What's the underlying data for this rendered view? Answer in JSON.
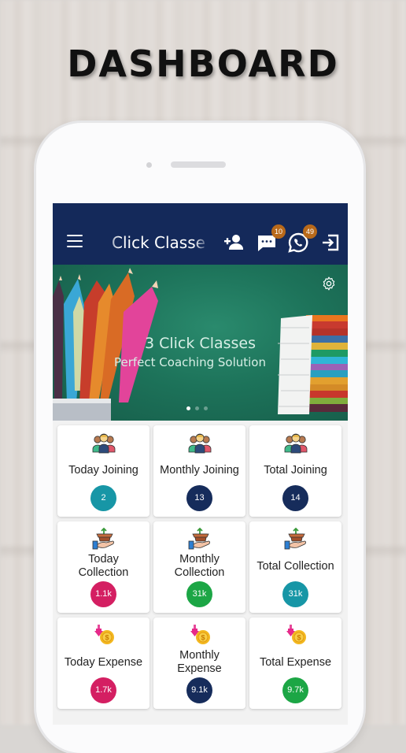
{
  "headline": "DASHBOARD",
  "app": {
    "title": "Click Classes",
    "badges": {
      "messages": "10",
      "whatsapp": "49"
    }
  },
  "banner": {
    "title": "3 Click Classes",
    "subtitle": "Perfect Coaching Solution",
    "slide_count": 3,
    "active_slide": 1
  },
  "cards": [
    {
      "label": "Today Joining",
      "value": "2",
      "icon": "people-icon",
      "color": "#1796a6"
    },
    {
      "label": "Monthly Joining",
      "value": "13",
      "icon": "people-icon",
      "color": "#162c5b"
    },
    {
      "label": "Total Joining",
      "value": "14",
      "icon": "people-icon",
      "color": "#162c5b"
    },
    {
      "label": "Today Collection",
      "value": "1.1k",
      "icon": "collection-icon",
      "color": "#d41f62"
    },
    {
      "label": "Monthly Collection",
      "value": "31k",
      "icon": "collection-icon",
      "color": "#1ca645"
    },
    {
      "label": "Total Collection",
      "value": "31k",
      "icon": "collection-icon",
      "color": "#1796a6"
    },
    {
      "label": "Today Expense",
      "value": "1.7k",
      "icon": "expense-icon",
      "color": "#d41f62"
    },
    {
      "label": "Monthly Expense",
      "value": "9.1k",
      "icon": "expense-icon",
      "color": "#162c5b"
    },
    {
      "label": "Total Expense",
      "value": "9.7k",
      "icon": "expense-icon",
      "color": "#1ca645"
    }
  ],
  "colors": {
    "appbar": "#14295a",
    "badge": "#b8691a",
    "banner": "#1d735a"
  }
}
